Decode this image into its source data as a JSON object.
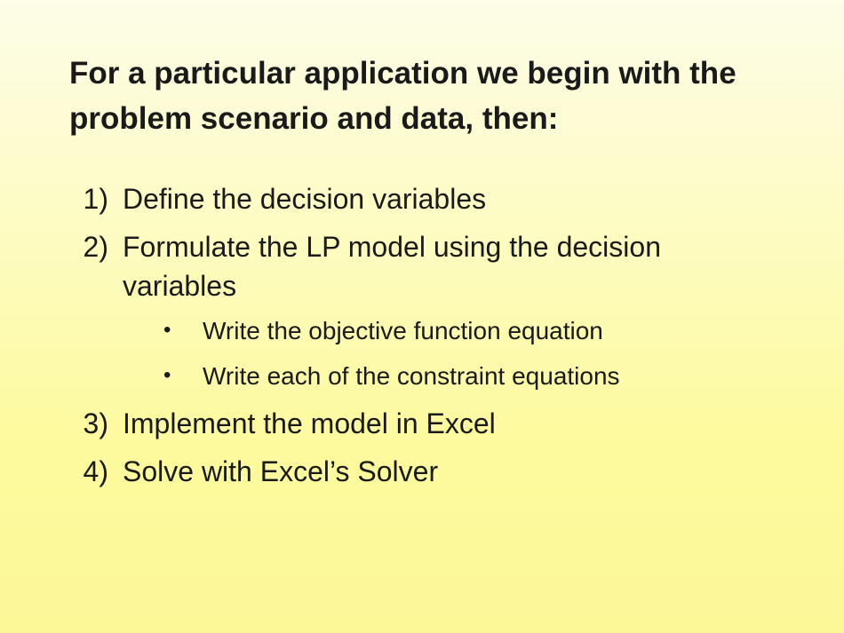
{
  "title": "For a particular application we begin with the problem scenario and data, then:",
  "items": [
    {
      "text": "Define the decision variables"
    },
    {
      "text": "Formulate the LP model using the decision variables",
      "subitems": [
        "Write the objective function equation",
        "Write each of the constraint equations"
      ]
    },
    {
      "text": "Implement the model in Excel"
    },
    {
      "text": "Solve with Excel’s Solver"
    }
  ]
}
